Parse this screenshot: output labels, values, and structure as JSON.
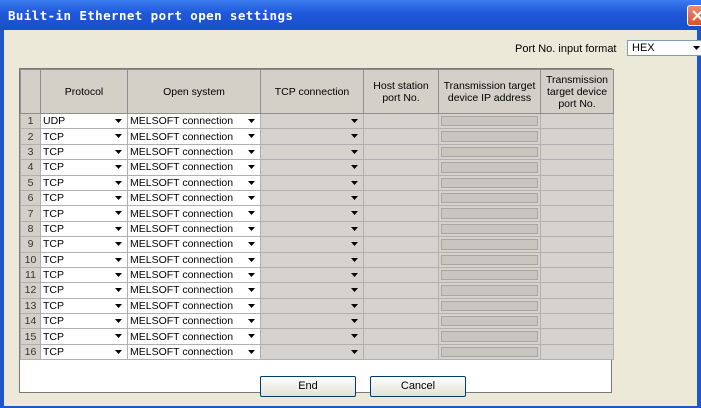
{
  "window": {
    "title": "Built-in Ethernet port open settings"
  },
  "port_format": {
    "label": "Port No. input format",
    "value": "HEX"
  },
  "table": {
    "headers": {
      "protocol": "Protocol",
      "open_system": "Open system",
      "tcp_connection": "TCP connection",
      "host_port": "Host station port No.",
      "target_ip": "Transmission target device IP address",
      "target_port": "Transmission target device port No."
    },
    "rows": [
      {
        "no": "1",
        "protocol": "UDP",
        "open_system": "MELSOFT connection",
        "tcp": ""
      },
      {
        "no": "2",
        "protocol": "TCP",
        "open_system": "MELSOFT connection",
        "tcp": ""
      },
      {
        "no": "3",
        "protocol": "TCP",
        "open_system": "MELSOFT connection",
        "tcp": ""
      },
      {
        "no": "4",
        "protocol": "TCP",
        "open_system": "MELSOFT connection",
        "tcp": ""
      },
      {
        "no": "5",
        "protocol": "TCP",
        "open_system": "MELSOFT connection",
        "tcp": ""
      },
      {
        "no": "6",
        "protocol": "TCP",
        "open_system": "MELSOFT connection",
        "tcp": ""
      },
      {
        "no": "7",
        "protocol": "TCP",
        "open_system": "MELSOFT connection",
        "tcp": ""
      },
      {
        "no": "8",
        "protocol": "TCP",
        "open_system": "MELSOFT connection",
        "tcp": ""
      },
      {
        "no": "9",
        "protocol": "TCP",
        "open_system": "MELSOFT connection",
        "tcp": ""
      },
      {
        "no": "10",
        "protocol": "TCP",
        "open_system": "MELSOFT connection",
        "tcp": ""
      },
      {
        "no": "11",
        "protocol": "TCP",
        "open_system": "MELSOFT connection",
        "tcp": ""
      },
      {
        "no": "12",
        "protocol": "TCP",
        "open_system": "MELSOFT connection",
        "tcp": ""
      },
      {
        "no": "13",
        "protocol": "TCP",
        "open_system": "MELSOFT connection",
        "tcp": ""
      },
      {
        "no": "14",
        "protocol": "TCP",
        "open_system": "MELSOFT connection",
        "tcp": ""
      },
      {
        "no": "15",
        "protocol": "TCP",
        "open_system": "MELSOFT connection",
        "tcp": ""
      },
      {
        "no": "16",
        "protocol": "TCP",
        "open_system": "MELSOFT connection",
        "tcp": ""
      }
    ]
  },
  "buttons": {
    "end": "End",
    "cancel": "Cancel"
  },
  "icons": {
    "close": "close-icon",
    "dropdown": "chevron-down-icon"
  },
  "colors": {
    "titlebar": "#1e57d8",
    "dialog": "#ece9d8",
    "grid_header": "#d4d0c8",
    "close_button": "#d9502a"
  }
}
